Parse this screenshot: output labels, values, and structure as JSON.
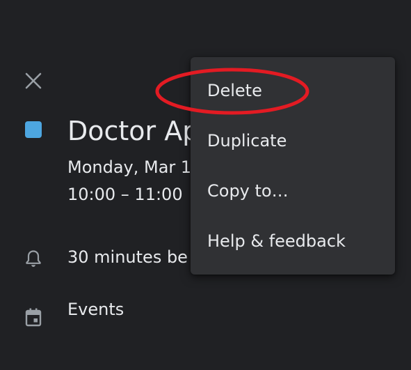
{
  "colors": {
    "background": "#202124",
    "menu_background": "#303134",
    "text": "#e8eaed",
    "icon": "#9aa0a6",
    "event_color": "#4da6e0",
    "annotation_red": "#e31b23"
  },
  "event": {
    "close_icon": "close-icon",
    "title": "Doctor Ap",
    "date": "Monday, Mar 1",
    "time": "10:00 – 11:00",
    "reminder": "30 minutes be",
    "reminder_icon": "bell-icon",
    "calendar": "Events",
    "calendar_icon": "calendar-icon"
  },
  "menu": {
    "items": [
      {
        "label": "Delete"
      },
      {
        "label": "Duplicate"
      },
      {
        "label": "Copy to…"
      },
      {
        "label": "Help & feedback"
      }
    ]
  }
}
